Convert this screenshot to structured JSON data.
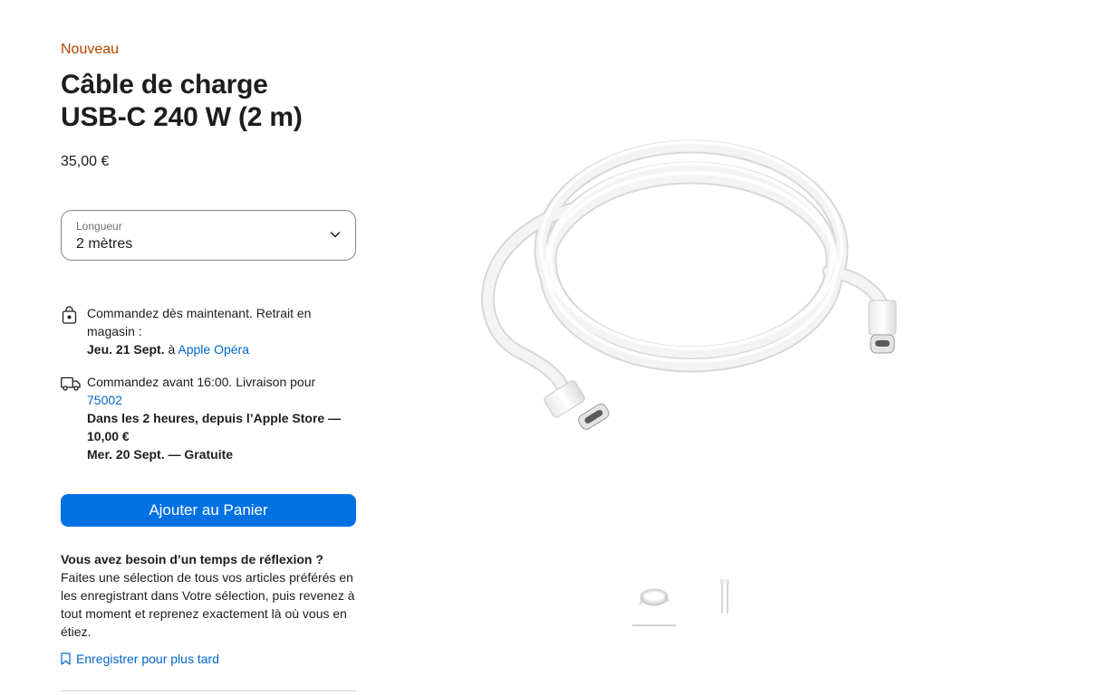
{
  "product": {
    "badge": "Nouveau",
    "title_line1": "Câble de charge",
    "title_line2": "USB-C 240 W (2 m)",
    "price": "35,00 €"
  },
  "length_select": {
    "label": "Longueur",
    "value": "2 mètres"
  },
  "pickup": {
    "line": "Commandez dès maintenant. Retrait en magasin :",
    "date": "Jeu. 21 Sept.",
    "at": " à ",
    "store": "Apple Opéra"
  },
  "delivery": {
    "line": "Commandez avant 16:00. Livraison pour",
    "postcode": "75002",
    "option1": "Dans les 2 heures, depuis l’Apple Store — 10,00 €",
    "option2": "Mer. 20 Sept. — Gratuite"
  },
  "add_to_cart_label": "Ajouter au Panier",
  "reflection": {
    "title": "Vous avez besoin d’un temps de réflexion ?",
    "body": "Faites une sélection de tous vos articles préférés en les enregistrant dans Votre sélection, puis revenez à tout moment et reprenez exactement là où vous en étiez.",
    "save_link": "Enregistrer pour plus tard"
  },
  "colors": {
    "badge": "#b64400",
    "button": "#0071e3",
    "link": "#0066cc"
  },
  "icons": {
    "pickup": "shopping-bag-icon",
    "delivery": "truck-icon",
    "chevron": "chevron-down-icon",
    "bookmark": "bookmark-icon"
  },
  "gallery": {
    "thumbnails": [
      "coiled-cable-thumbnail",
      "straight-cable-thumbnail"
    ],
    "active_index": 0
  }
}
